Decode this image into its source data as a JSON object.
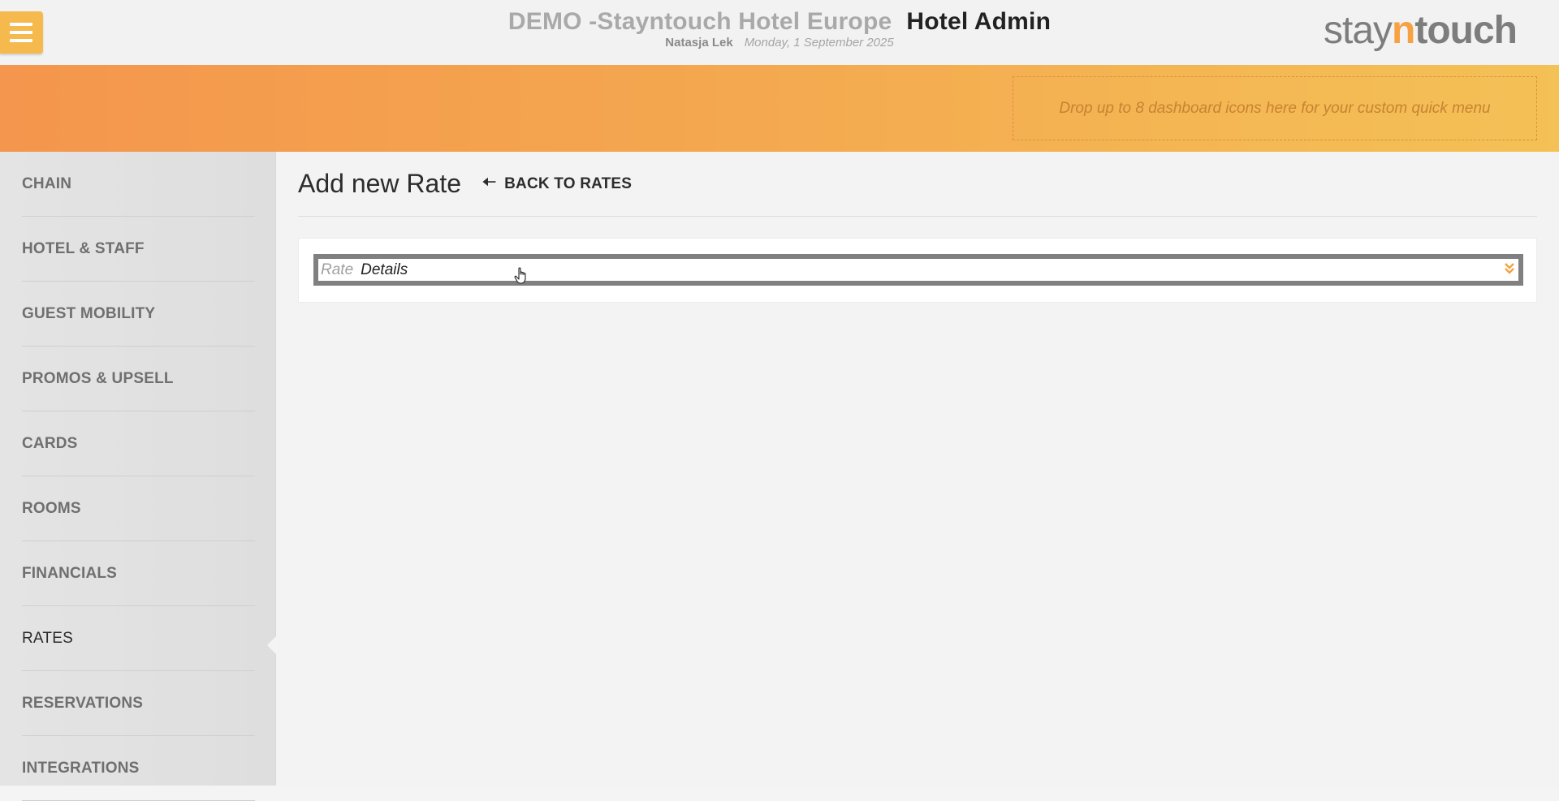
{
  "header": {
    "hotel_name": "DEMO -Stayntouch Hotel Europe",
    "app_name": "Hotel Admin",
    "user_name": "Natasja Lek",
    "date": "Monday, 1 September 2025",
    "logo": {
      "part1": "stay",
      "part2": "n",
      "part3": "touch"
    },
    "menu_icon": "hamburger-icon"
  },
  "banner": {
    "dropzone_text": "Drop up to 8 dashboard icons here for your custom quick menu"
  },
  "sidebar": {
    "items": [
      {
        "label": "CHAIN",
        "active": false
      },
      {
        "label": "HOTEL & STAFF",
        "active": false
      },
      {
        "label": "GUEST MOBILITY",
        "active": false
      },
      {
        "label": "PROMOS & UPSELL",
        "active": false
      },
      {
        "label": "CARDS",
        "active": false
      },
      {
        "label": "ROOMS",
        "active": false
      },
      {
        "label": "FINANCIALS",
        "active": false
      },
      {
        "label": "RATES",
        "active": true
      },
      {
        "label": "RESERVATIONS",
        "active": false
      },
      {
        "label": "INTEGRATIONS",
        "active": false
      }
    ]
  },
  "main": {
    "page_title": "Add new Rate",
    "back_label": "BACK TO RATES",
    "back_icon": "arrow-left-icon",
    "form": {
      "rate_name_label": "Rate",
      "rate_name_value": "Details",
      "expand_icon": "double-chevron-down-icon"
    }
  },
  "colors": {
    "accent": "#f6b94e",
    "banner_start": "#f4964d",
    "banner_end": "#f4c156",
    "logo_accent": "#f6a142",
    "field_border": "#808080"
  }
}
